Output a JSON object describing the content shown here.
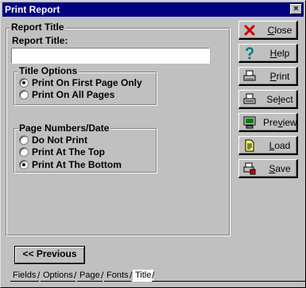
{
  "window": {
    "title": "Print Report",
    "close_glyph": "×"
  },
  "report_title_group": {
    "legend": "Report Title",
    "field_label": "Report Title:",
    "field_value": ""
  },
  "title_options": {
    "legend": "Title Options",
    "options": [
      {
        "label": "Print On First Page Only",
        "checked": true
      },
      {
        "label": "Print On All Pages",
        "checked": false
      }
    ]
  },
  "page_numbers": {
    "legend": "Page Numbers/Date",
    "options": [
      {
        "label": "Do Not Print",
        "checked": false
      },
      {
        "label": "Print At The Top",
        "checked": false
      },
      {
        "label": "Print At The Bottom",
        "checked": true
      }
    ]
  },
  "buttons": {
    "close": {
      "accel": "C",
      "rest": "lose",
      "icon": "red-x-icon"
    },
    "help": {
      "accel": "H",
      "rest": "elp",
      "icon": "question-mark-icon"
    },
    "print": {
      "accel": "P",
      "rest": "rint",
      "icon": "printer-icon"
    },
    "select": {
      "prefix": "Se",
      "accel": "l",
      "rest": "ect",
      "icon": "printer-setup-icon"
    },
    "preview": {
      "prefix": "Pre",
      "accel": "v",
      "rest": "iew",
      "icon": "monitor-icon"
    },
    "load": {
      "accel": "L",
      "rest": "oad",
      "icon": "document-open-icon"
    },
    "save": {
      "accel": "S",
      "rest": "ave",
      "icon": "printer-save-icon"
    }
  },
  "previous_button": "<< Previous",
  "tabs": [
    {
      "label": "Fields",
      "active": false
    },
    {
      "label": "Options",
      "active": false
    },
    {
      "label": "Page",
      "active": false
    },
    {
      "label": "Fonts",
      "active": false
    },
    {
      "label": "Title",
      "active": true
    }
  ],
  "colors": {
    "titlebar": "#000080",
    "face": "#c0c0c0",
    "close_icon": "#cc0000",
    "help_icon": "#008080"
  }
}
